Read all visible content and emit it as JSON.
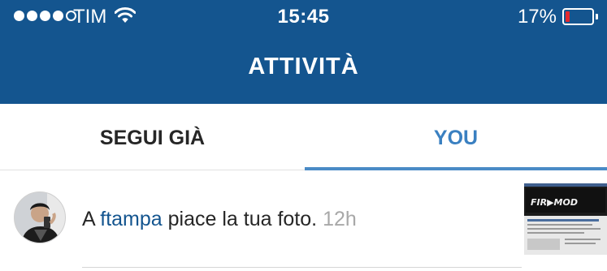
{
  "status_bar": {
    "carrier": "TIM",
    "time": "15:45",
    "battery_percent": "17%",
    "battery_level": 0.17,
    "signal_bars_filled": 4,
    "signal_bars_total": 5,
    "battery_color": "#e3282e"
  },
  "header": {
    "title": "ATTIVITÀ",
    "background_color": "#14558f"
  },
  "tabs": [
    {
      "label": "SEGUI GIÀ",
      "selected": false
    },
    {
      "label": "YOU",
      "selected": true
    }
  ],
  "activity": {
    "prefix": "A",
    "username": "ftampa",
    "message": "piace la tua foto.",
    "time": "12h",
    "avatar_icon": "user-avatar",
    "thumbnail_icon": "post-thumbnail",
    "thumbnail_text": "FIR▶MOD"
  }
}
